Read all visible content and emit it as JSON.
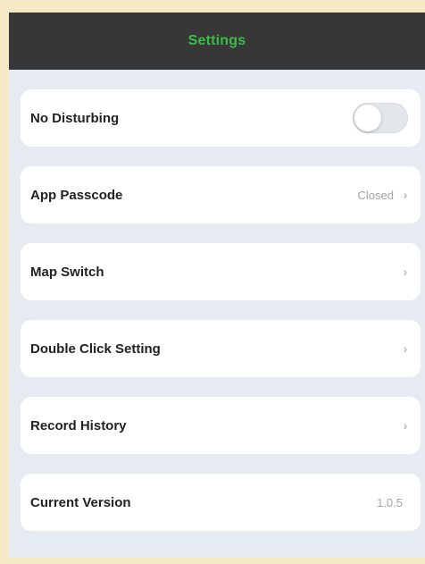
{
  "header": {
    "title": "Settings",
    "title_color": "#3dbb4a",
    "background_color": "#373737"
  },
  "settings": {
    "no_disturbing": {
      "label": "No Disturbing",
      "toggle_on": false
    },
    "app_passcode": {
      "label": "App Passcode",
      "value": "Closed",
      "chevron": "›"
    },
    "map_switch": {
      "label": "Map Switch",
      "chevron": "›"
    },
    "double_click_setting": {
      "label": "Double Click Setting",
      "chevron": "›"
    },
    "record_history": {
      "label": "Record History",
      "chevron": "›"
    },
    "current_version": {
      "label": "Current Version",
      "value": "1.0.5"
    }
  },
  "icons": {
    "chevron": "chevron-right-icon",
    "toggle": "toggle-switch-icon"
  }
}
